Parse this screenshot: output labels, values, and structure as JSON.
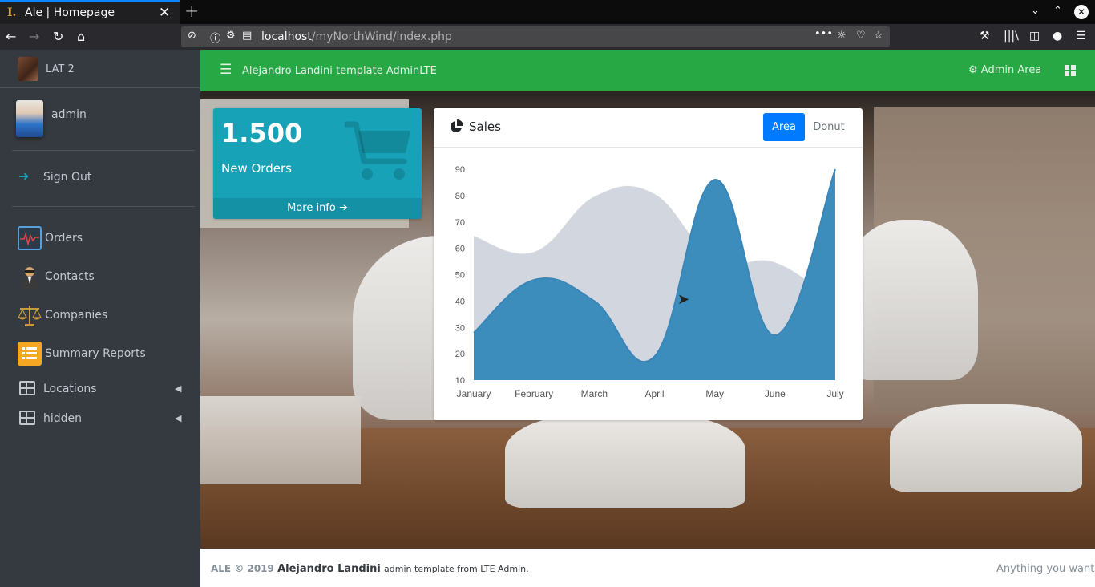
{
  "browser": {
    "tab_title": "Ale | Homepage",
    "tab_close": "✕",
    "new_tab": "+",
    "url_host": "localhost",
    "url_path": "/myNorthWind/index.php",
    "url_more": "•••"
  },
  "sidebar": {
    "brand": "LAT 2",
    "user": "admin",
    "sign_out": "Sign Out",
    "items": [
      {
        "label": "Orders",
        "icon": "orders-icon"
      },
      {
        "label": "Contacts",
        "icon": "contacts-icon"
      },
      {
        "label": "Companies",
        "icon": "companies-icon"
      },
      {
        "label": "Summary Reports",
        "icon": "summary-reports-icon"
      },
      {
        "label": "Locations",
        "icon": "table-icon"
      },
      {
        "label": "hidden",
        "icon": "table-icon"
      }
    ]
  },
  "topnav": {
    "title": "Alejandro Landini template AdminLTE",
    "admin_area": "Admin Area"
  },
  "small_box": {
    "value": "1.500",
    "label": "New Orders",
    "more_info": "More info"
  },
  "card": {
    "title": "Sales",
    "btn_area": "Area",
    "btn_donut": "Donut"
  },
  "chart_data": {
    "type": "area",
    "categories": [
      "January",
      "February",
      "March",
      "April",
      "May",
      "June",
      "July"
    ],
    "series": [
      {
        "values": [
          65,
          59,
          80,
          81,
          56,
          55,
          40
        ],
        "color": "#d2d6de"
      },
      {
        "values": [
          28,
          48,
          40,
          19,
          86,
          27,
          90
        ],
        "color": "#3c8dbc"
      }
    ],
    "ylim": [
      10,
      90
    ],
    "yticks": [
      "90",
      "80",
      "70",
      "60",
      "50",
      "40",
      "30",
      "20",
      "10"
    ],
    "grid": false
  },
  "footer": {
    "left_prefix": "ALE © 2019",
    "left_name": "Alejandro Landini",
    "left_suffix": "admin template from LTE Admin.",
    "right": "Anything you want"
  },
  "colors": {
    "accent_green": "#28a745",
    "info": "#17a2b8",
    "primary": "#007bff",
    "sidebar": "#343a40"
  }
}
